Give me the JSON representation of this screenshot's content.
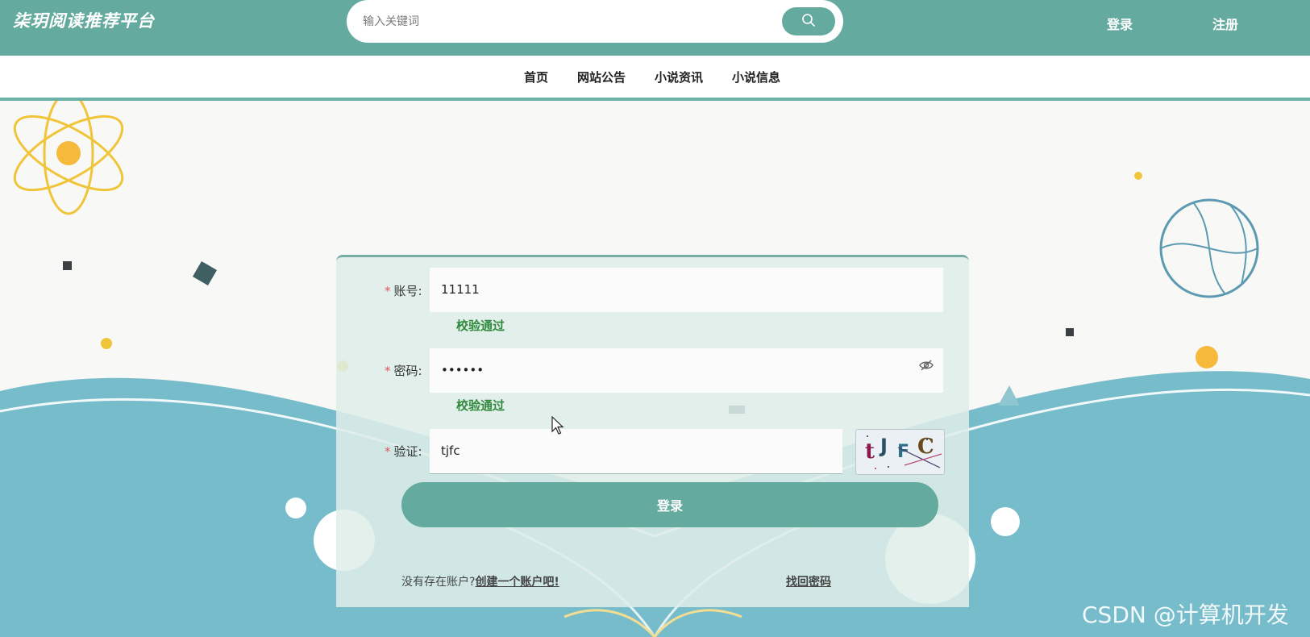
{
  "header": {
    "brand": "柒玥阅读推荐平台",
    "search_placeholder": "输入关键词",
    "search_icon": "search-icon",
    "login_label": "登录",
    "register_label": "注册"
  },
  "nav": {
    "items": [
      {
        "label": "首页"
      },
      {
        "label": "网站公告"
      },
      {
        "label": "小说资讯"
      },
      {
        "label": "小说信息"
      }
    ]
  },
  "form": {
    "account": {
      "label": "账号:",
      "value": "11111",
      "hint": "校验通过"
    },
    "password": {
      "label": "密码:",
      "value": "••••••",
      "hint": "校验通过",
      "icon": "eye-off-icon"
    },
    "captcha": {
      "label": "验证:",
      "value": "tjfc",
      "image_text": "tJFC"
    },
    "required_mark": "*",
    "submit_label": "登录",
    "no_account_text": "没有存在账户?",
    "create_account_link": "创建一个账户吧!",
    "find_password_link": "找回密码"
  },
  "watermark": "CSDN @计算机开发",
  "colors": {
    "primary": "#65aa9f",
    "success": "#2f8a3b",
    "background": "#f8f8f6",
    "wave": "#77bccb"
  }
}
